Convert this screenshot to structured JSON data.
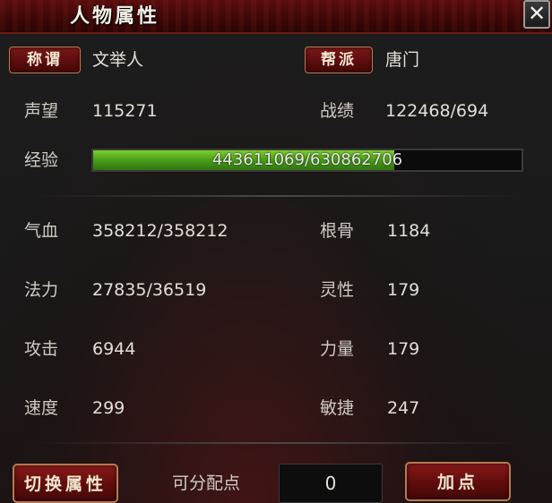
{
  "window": {
    "title": "人物属性",
    "close_icon": "close-icon"
  },
  "header": {
    "title_button_label": "称谓",
    "title_value": "文举人",
    "faction_button_label": "帮派",
    "faction_value": "唐门"
  },
  "stats_top": {
    "prestige_label": "声望",
    "prestige_value": "115271",
    "record_label": "战绩",
    "record_value": "122468/694",
    "exp_label": "经验",
    "exp_text": "443611069/630862706",
    "exp_fraction": 0.703
  },
  "stats_left": [
    {
      "label": "气血",
      "value": "358212/358212"
    },
    {
      "label": "法力",
      "value": "27835/36519"
    },
    {
      "label": "攻击",
      "value": "6944"
    },
    {
      "label": "速度",
      "value": "299"
    }
  ],
  "stats_right": [
    {
      "label": "根骨",
      "value": "1184"
    },
    {
      "label": "灵性",
      "value": "179"
    },
    {
      "label": "力量",
      "value": "179"
    },
    {
      "label": "敏捷",
      "value": "247"
    }
  ],
  "footer": {
    "switch_button_label": "切换属性",
    "points_label": "可分配点",
    "points_value": "0",
    "add_button_label": "加点"
  },
  "colors": {
    "title_bar": "#4a0909",
    "button_red": "#6a1010",
    "button_border": "#b47a52",
    "exp_green": "#4ea11a"
  }
}
